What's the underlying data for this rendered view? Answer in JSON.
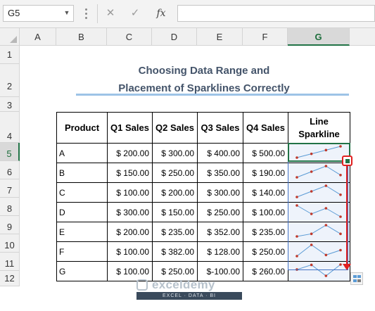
{
  "name_box": "G5",
  "formula_icons": {
    "cancel": "✕",
    "enter": "✓",
    "fx": "fx"
  },
  "columns": [
    "A",
    "B",
    "C",
    "D",
    "E",
    "F",
    "G"
  ],
  "rows": [
    "1",
    "2",
    "3",
    "4",
    "5",
    "6",
    "7",
    "8",
    "9",
    "10",
    "11",
    "12"
  ],
  "selected_cell": {
    "column": "G",
    "row": "5"
  },
  "title": {
    "line1": "Choosing Data Range and",
    "line2": "Placement of Sparklines Correctly"
  },
  "table": {
    "headers": [
      "Product",
      "Q1 Sales",
      "Q2 Sales",
      "Q3 Sales",
      "Q4 Sales"
    ],
    "spark_header": {
      "line1": "Line",
      "line2": "Sparkline"
    },
    "rows": [
      {
        "product": "A",
        "values": [
          "$ 200.00",
          "$ 300.00",
          "$ 400.00",
          "$ 500.00"
        ]
      },
      {
        "product": "B",
        "values": [
          "$ 150.00",
          "$ 250.00",
          "$ 350.00",
          "$ 190.00"
        ]
      },
      {
        "product": "C",
        "values": [
          "$ 100.00",
          "$ 200.00",
          "$ 300.00",
          "$ 140.00"
        ]
      },
      {
        "product": "D",
        "values": [
          "$ 300.00",
          "$ 150.00",
          "$ 250.00",
          "$ 100.00"
        ]
      },
      {
        "product": "E",
        "values": [
          "$ 200.00",
          "$ 235.00",
          "$ 352.00",
          "$ 235.00"
        ]
      },
      {
        "product": "F",
        "values": [
          "$ 100.00",
          "$ 382.00",
          "$ 128.00",
          "$ 250.00"
        ]
      },
      {
        "product": "G",
        "values": [
          "$ 100.00",
          "$ 250.00",
          "$-100.00",
          "$ 260.00"
        ]
      }
    ],
    "sparkline_values": [
      [
        200,
        300,
        400,
        500
      ],
      [
        150,
        250,
        350,
        190
      ],
      [
        100,
        200,
        300,
        140
      ],
      [
        300,
        150,
        250,
        100
      ],
      [
        200,
        235,
        352,
        235
      ],
      [
        100,
        382,
        128,
        250
      ],
      [
        100,
        250,
        -100,
        260
      ]
    ]
  },
  "colors": {
    "sparkline_line": "#5b9bd5",
    "sparkline_marker": "#c0392b",
    "selection": "#217346",
    "drag_arrow": "#e02020",
    "title": "#44546a"
  },
  "watermark": {
    "brand": "exceldemy",
    "tagline": "EXCEL · DATA · BI"
  }
}
